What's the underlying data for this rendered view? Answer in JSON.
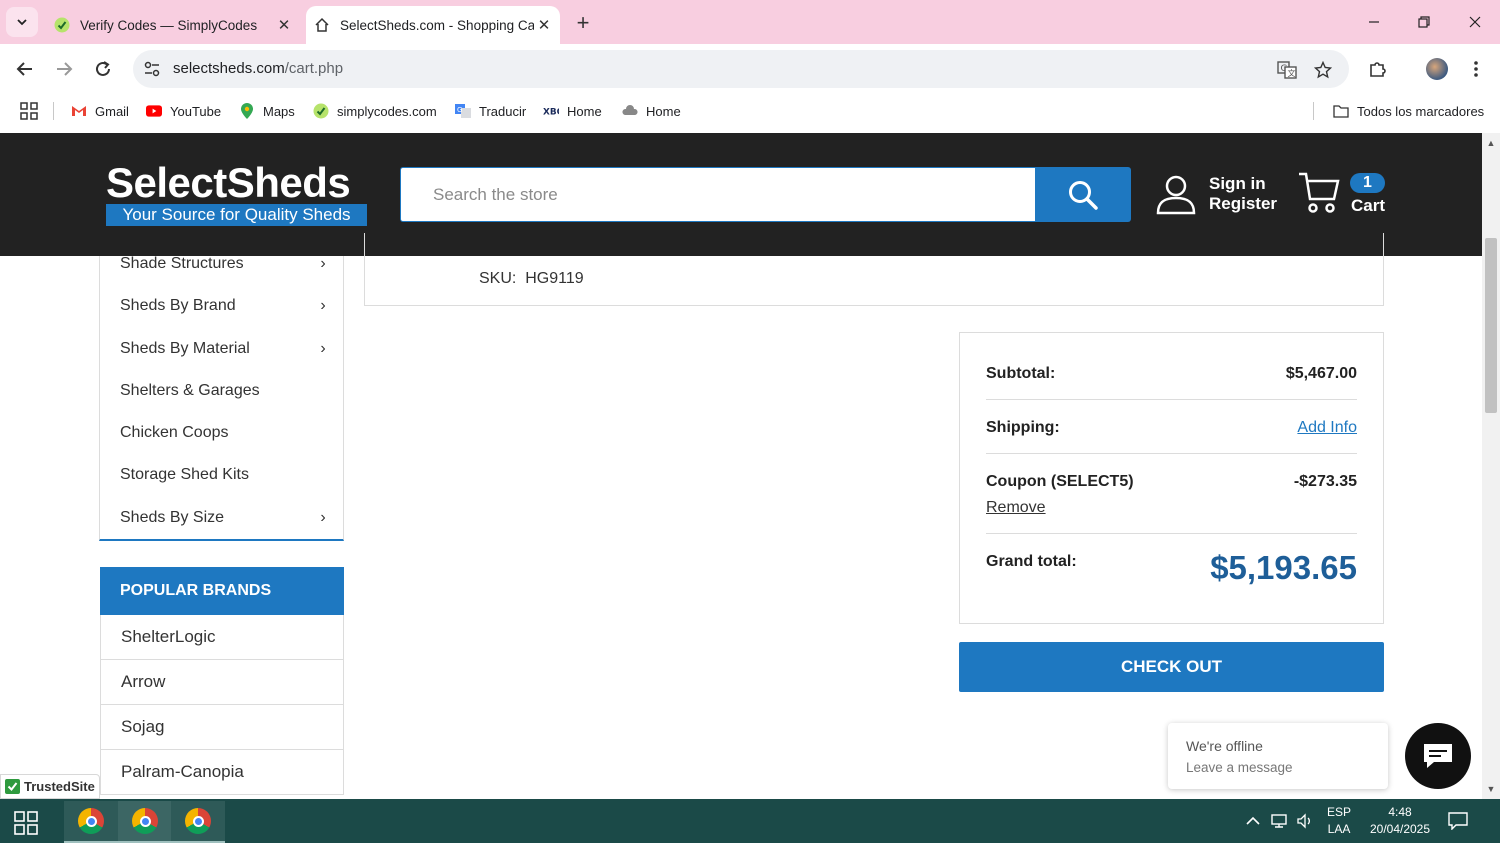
{
  "browser": {
    "tabs": [
      {
        "title": "Verify Codes — SimplyCodes",
        "active": false,
        "favicon": "simplycodes-icon"
      },
      {
        "title": "SelectSheds.com - Shopping Ca",
        "active": true,
        "favicon": "home-icon"
      }
    ],
    "address": {
      "domain": "selectsheds.com",
      "path": "/cart.php"
    },
    "bookmarks": [
      {
        "label": "Gmail",
        "icon": "gmail-icon"
      },
      {
        "label": "YouTube",
        "icon": "youtube-icon"
      },
      {
        "label": "Maps",
        "icon": "maps-icon"
      },
      {
        "label": "simplycodes.com",
        "icon": "simplycodes-icon"
      },
      {
        "label": "Traducir",
        "icon": "translate-icon"
      },
      {
        "label": "Home",
        "icon": "home-logo-icon"
      },
      {
        "label": "Home",
        "icon": "home-cloud-icon"
      }
    ],
    "all_bookmarks_label": "Todos los marcadores"
  },
  "header": {
    "logo_main": "SelectSheds",
    "logo_tagline": "Your Source for Quality Sheds",
    "search_placeholder": "Search the store",
    "sign_in": "Sign in",
    "register": "Register",
    "cart_count": "1",
    "cart_label": "Cart",
    "accent_color": "#1e78c1"
  },
  "sidebar": {
    "categories": [
      {
        "label": "Shade Structures",
        "has_submenu": true
      },
      {
        "label": "Sheds By Brand",
        "has_submenu": true
      },
      {
        "label": "Sheds By Material",
        "has_submenu": true
      },
      {
        "label": "Shelters & Garages",
        "has_submenu": false
      },
      {
        "label": "Chicken Coops",
        "has_submenu": false
      },
      {
        "label": "Storage Shed Kits",
        "has_submenu": false
      },
      {
        "label": "Sheds By Size",
        "has_submenu": true
      }
    ],
    "brands_heading": "POPULAR BRANDS",
    "brands": [
      "ShelterLogic",
      "Arrow",
      "Sojag",
      "Palram-Canopia"
    ]
  },
  "product": {
    "sku_label": "SKU:",
    "sku_value": "HG9119"
  },
  "totals": {
    "subtotal_label": "Subtotal:",
    "subtotal_value": "$5,467.00",
    "shipping_label": "Shipping:",
    "shipping_value": "Add Info",
    "coupon_label": "Coupon (SELECT5)",
    "coupon_value": "-$273.35",
    "coupon_remove": "Remove",
    "grand_label": "Grand total:",
    "grand_value": "$5,193.65",
    "checkout_label": "CHECK OUT"
  },
  "chat": {
    "status": "We're offline",
    "prompt": "Leave a message"
  },
  "trusted_badge": "TrustedSite",
  "taskbar": {
    "lang_top": "ESP",
    "lang_bottom": "LAA",
    "time": "4:48",
    "date": "20/04/2025"
  }
}
